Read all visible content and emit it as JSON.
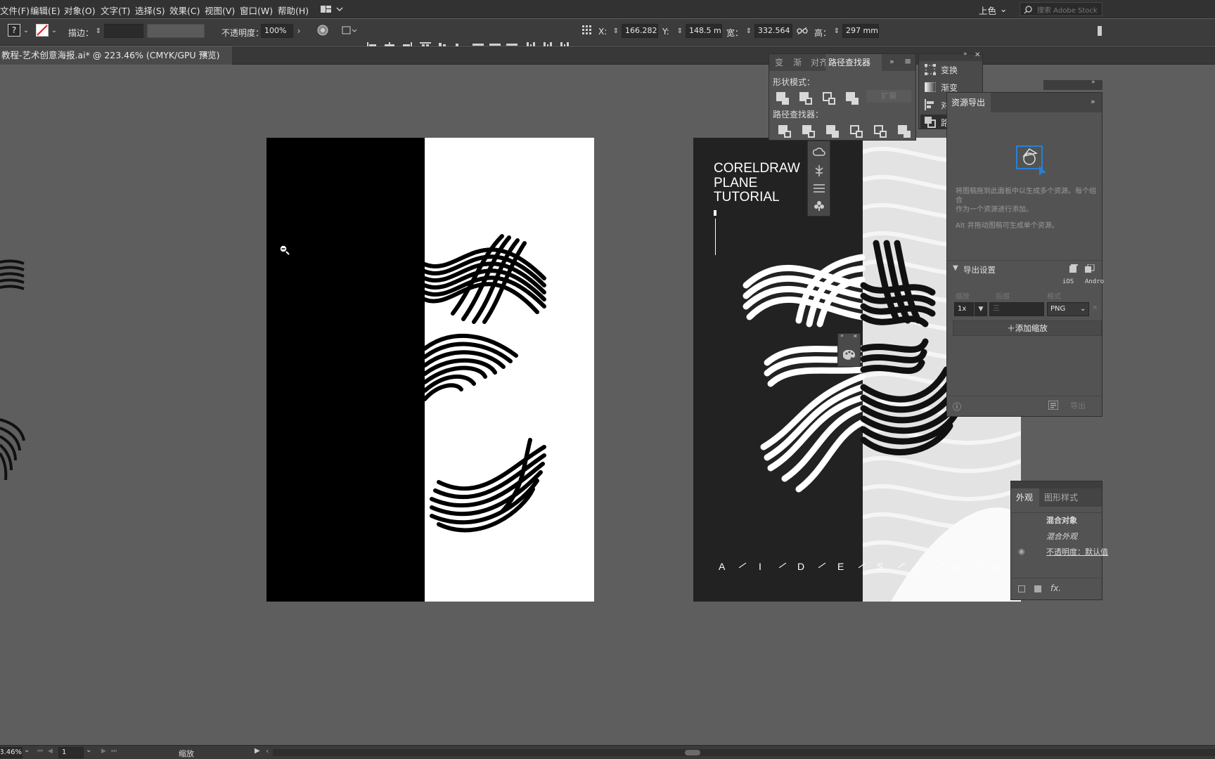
{
  "menu": [
    "文件(F)",
    "编辑(E)",
    "对象(O)",
    "文字(T)",
    "选择(S)",
    "效果(C)",
    "视图(V)",
    "窗口(W)",
    "帮助(H)"
  ],
  "workspace_label": "上色",
  "search_placeholder": "搜索 Adobe Stock",
  "control": {
    "stroke_label": "描边：",
    "opacity_label": "不透明度：",
    "opacity_value": "100%",
    "x_label": "X:",
    "x_value": "166.282 n",
    "y_label": "Y:",
    "y_value": "148.5 mm",
    "w_label": "宽：",
    "w_value": "332.564 n",
    "h_label": "高：",
    "h_value": "297 mm"
  },
  "doc_tab": {
    "title": "教程-艺术创意海报.ai* @ 223.46% (CMYK/GPU 预览)",
    "close": "×"
  },
  "poster": {
    "title_lines": [
      "CORELDRAW",
      "PLANE",
      "TUTORIAL"
    ],
    "letters": [
      "A",
      "I",
      "D",
      "E",
      "S",
      "I",
      "G",
      "N"
    ]
  },
  "pathfinder_panel": {
    "tabs": [
      "变",
      "渐",
      "对齐",
      "路径查找器"
    ],
    "shape_modes_label": "形状模式：",
    "expand_label": "扩展",
    "pathfinders_label": "路径查找器："
  },
  "collapsed_panel": {
    "items": [
      "变换",
      "渐变",
      "对",
      "路"
    ]
  },
  "asset_export": {
    "tab": "资源导出",
    "hint1": "将图稿拖到此面板中以生成多个资源。每个组合",
    "hint1b": "作为一个资源进行添加。",
    "hint2": "Alt 并拖动图稿可生成单个资源。",
    "export_settings": "导出设置",
    "ios": "iOS",
    "android": "Andro",
    "col_scale": "缩放",
    "col_suffix": "后缀",
    "col_format": "格式",
    "scale_value": "1x",
    "format_value": "PNG",
    "add_scale": "添加缩放",
    "export_btn": "导出"
  },
  "appearance": {
    "tabs": [
      "外观",
      "图形样式"
    ],
    "row1": "混合对象",
    "row2": "混合外观",
    "row3": "不透明度：默认值",
    "fx": "fx."
  },
  "status": {
    "zoom": "223.46%",
    "page": "1",
    "tool": "缩放"
  }
}
